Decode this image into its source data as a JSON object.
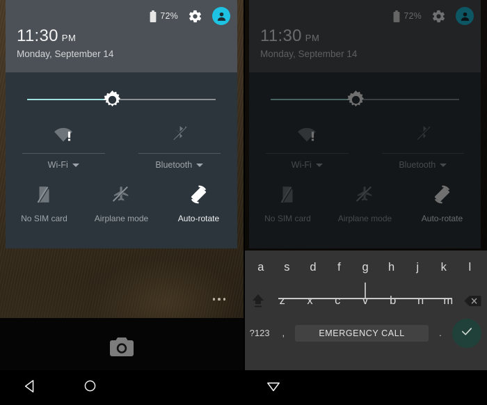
{
  "screens": [
    {
      "id": "left",
      "name": "quick-settings-expanded",
      "dimmed": false,
      "status": {
        "battery_percent": "72%",
        "battery_icon": "battery-icon",
        "settings_icon": "gear-icon",
        "user_icon": "user-avatar-icon",
        "avatar_color": "#1ec3e4"
      },
      "clock": {
        "time": "11:30",
        "ampm": "PM",
        "date": "Monday, September 14"
      },
      "brightness": {
        "label": "brightness-slider",
        "value": 45,
        "icon": "brightness-sun-icon"
      },
      "dual_tiles": [
        {
          "label": "Wi-Fi",
          "icon": "wifi-alert-icon",
          "state": "disconnected",
          "has_dropdown": true
        },
        {
          "label": "Bluetooth",
          "icon": "bluetooth-off-icon",
          "state": "off",
          "has_dropdown": true
        }
      ],
      "tiles": [
        {
          "label": "No SIM card",
          "icon": "sim-card-off-icon",
          "active": false
        },
        {
          "label": "Airplane mode",
          "icon": "airplane-off-icon",
          "active": false
        },
        {
          "label": "Auto-rotate",
          "icon": "auto-rotate-icon",
          "active": true
        }
      ],
      "lockscreen": {
        "overflow_icon": "overflow-dots-icon",
        "camera_icon": "camera-icon"
      },
      "navbar": [
        {
          "icon": "back-triangle-icon",
          "name": "nav-back"
        },
        {
          "icon": "home-circle-icon",
          "name": "nav-home"
        }
      ]
    },
    {
      "id": "right",
      "name": "quick-settings-dimmed-with-keyboard",
      "dimmed": true,
      "status": {
        "battery_percent": "72%",
        "battery_icon": "battery-icon",
        "settings_icon": "gear-icon",
        "user_icon": "user-avatar-icon",
        "avatar_color": "#1ec3e4"
      },
      "clock": {
        "time": "11:30",
        "ampm": "PM",
        "date": "Monday, September 14"
      },
      "brightness": {
        "label": "brightness-slider",
        "value": 45,
        "icon": "brightness-sun-icon"
      },
      "dual_tiles": [
        {
          "label": "Wi-Fi",
          "icon": "wifi-alert-icon",
          "state": "disconnected",
          "has_dropdown": true
        },
        {
          "label": "Bluetooth",
          "icon": "bluetooth-off-icon",
          "state": "off",
          "has_dropdown": true
        }
      ],
      "tiles": [
        {
          "label": "No SIM card",
          "icon": "sim-card-off-icon",
          "active": false
        },
        {
          "label": "Airplane mode",
          "icon": "airplane-off-icon",
          "active": false
        },
        {
          "label": "Auto-rotate",
          "icon": "auto-rotate-icon",
          "active": true
        }
      ],
      "keyboard": {
        "password_field": {
          "value": "",
          "placeholder": ""
        },
        "row_middle": [
          "a",
          "s",
          "d",
          "f",
          "g",
          "h",
          "j",
          "k",
          "l"
        ],
        "row_bottom": [
          "z",
          "x",
          "c",
          "v",
          "b",
          "n",
          "m"
        ],
        "shift_icon": "shift-caps-icon",
        "backspace_icon": "backspace-icon",
        "symbols_key": "?123",
        "comma_key": ",",
        "period_key": ".",
        "emergency_label": "EMERGENCY CALL",
        "enter_icon": "check-icon",
        "enter_color": "#1f4139"
      },
      "navbar": [
        {
          "icon": "hide-keyboard-triangle-icon",
          "name": "nav-hide-keyboard"
        }
      ]
    }
  ]
}
